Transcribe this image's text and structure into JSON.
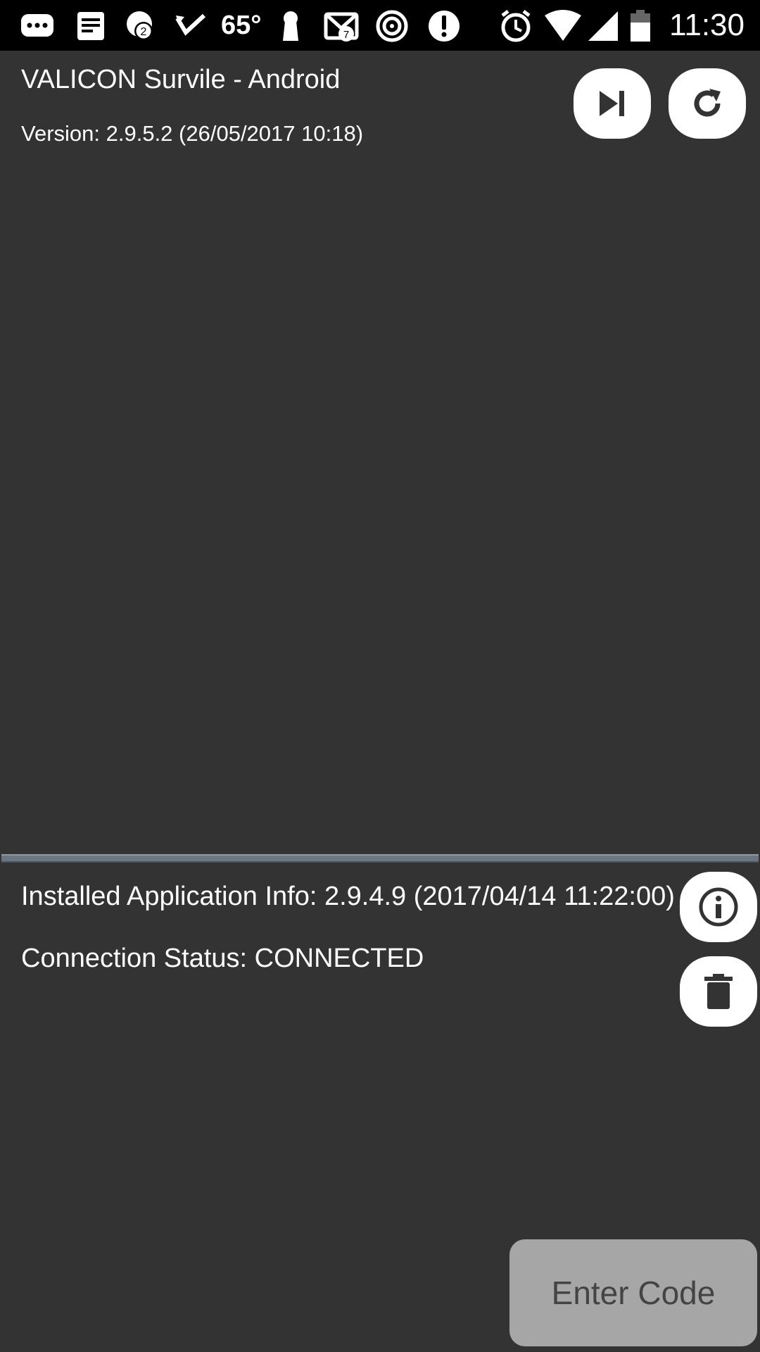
{
  "status_bar": {
    "temperature": "65°",
    "time": "11:30",
    "icons": [
      "chat-bubble-icon",
      "notes-icon",
      "hangouts-icon",
      "missed-call-icon",
      "keyhole-icon",
      "gmail-icon",
      "spiral-icon",
      "alert-icon",
      "alarm-icon",
      "wifi-icon",
      "signal-icon",
      "battery-icon"
    ],
    "badges": {
      "hangouts": "2",
      "gmail": "7"
    }
  },
  "header": {
    "title": "VALICON Survile - Android",
    "version": "Version: 2.9.5.2 (26/05/2017 10:18)"
  },
  "info": {
    "installed": "Installed Application Info: 2.9.4.9 (2017/04/14 11:22:00)",
    "connection": "Connection Status: CONNECTED"
  },
  "actions": {
    "enter_code_label": "Enter Code"
  },
  "colors": {
    "background": "#333333",
    "status_bar": "#000000",
    "button": "#ffffff",
    "enter_code_bg": "#a6a6a6",
    "divider": "#6b7680"
  }
}
